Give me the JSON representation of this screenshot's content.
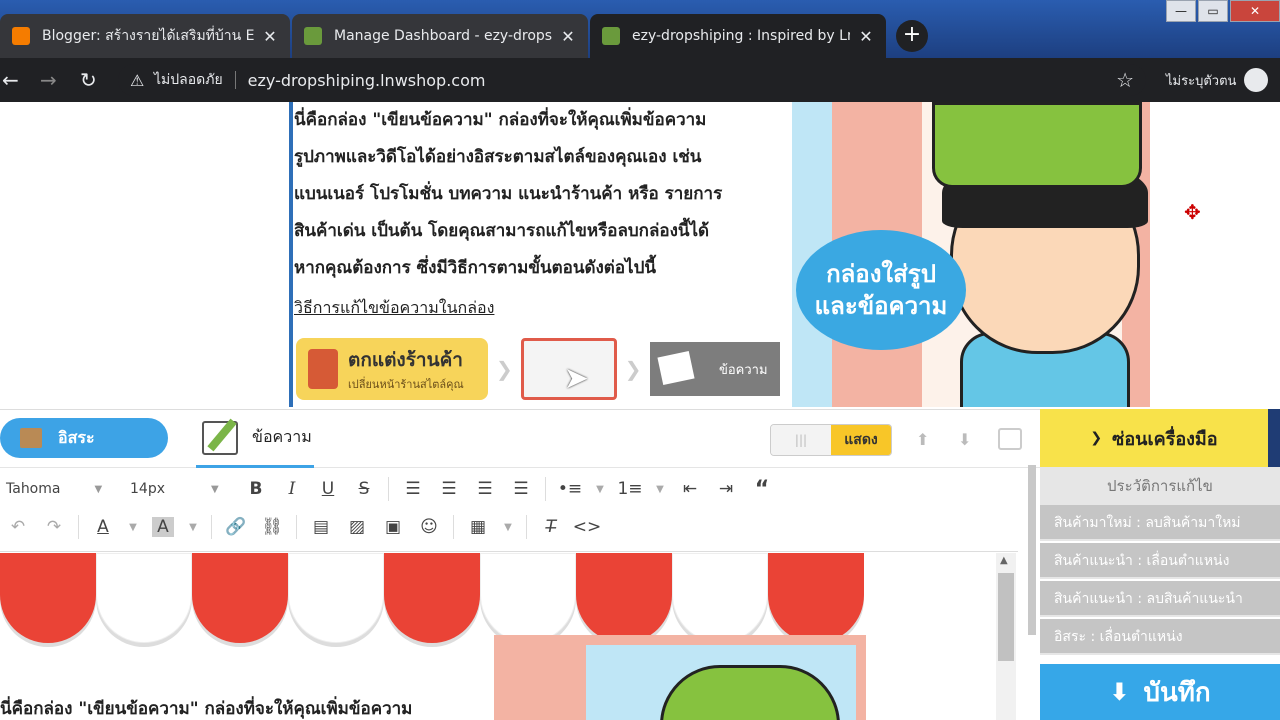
{
  "browser": {
    "tabs": [
      {
        "title": "Blogger: สร้างรายได้เสริมที่บ้าน EZY-I",
        "favicon_color": "#f57c00"
      },
      {
        "title": "Manage Dashboard - ezy-dropsh",
        "favicon_color": "#6a9a3c"
      },
      {
        "title": "ezy-dropshiping : Inspired by Lnw",
        "favicon_color": "#6a9a3c"
      }
    ],
    "security_label": "ไม่ปลอดภัย",
    "url": "ezy-dropshiping.lnwshop.com",
    "profile_label": "ไม่ระบุตัวตน"
  },
  "preview": {
    "lines": [
      "นี่คือกล่อง \"เขียนข้อความ\" กล่องที่จะให้คุณเพิ่มข้อความ",
      "รูปภาพและวิดีโอได้อย่างอิสระตามสไตล์ของคุณเอง เช่น",
      "แบนเนอร์ โปรโมชั่น บทความ แนะนำร้านค้า หรือ รายการ",
      "สินค้าเด่น เป็นต้น โดยคุณสามารถแก้ไขหรือลบกล่องนี้ได้",
      "หากคุณต้องการ ซึ่งมีวิธีการตามขั้นตอนดังต่อไปนี้"
    ],
    "link": "วิธีการแก้ไขข้อความในกล่อง",
    "step1_title": "ตกแต่งร้านค้า",
    "step1_sub": "เปลี่ยนหน้าร้านสไตล์คุณ",
    "step3_label": "ข้อความ",
    "bubble_line1": "กล่องใส่รูป",
    "bubble_line2": "และข้อความ"
  },
  "editor": {
    "free_label": "อิสระ",
    "text_tab_label": "ข้อความ",
    "show_label": "แสดง",
    "toggle_off": "|||",
    "font": "Tahoma",
    "size": "14px",
    "content_text": "นี่คือกล่อง \"เขียนข้อความ\" กล่องที่จะให้คุณเพิ่มข้อความ"
  },
  "panel": {
    "hide_tools": "ซ่อนเครื่องมือ",
    "history_title": "ประวัติการแก้ไข",
    "history": [
      "สินค้ามาใหม่ : ลบสินค้ามาใหม่",
      "สินค้าแนะนำ : เลื่อนตำแหน่ง",
      "สินค้าแนะนำ : ลบสินค้าแนะนำ",
      "อิสระ : เลื่อนตำแหน่ง"
    ],
    "save": "บันทึก"
  },
  "colors": {
    "accent_blue": "#3da3e6",
    "accent_yellow": "#f8e24a",
    "awning_red": "#ea4336"
  }
}
